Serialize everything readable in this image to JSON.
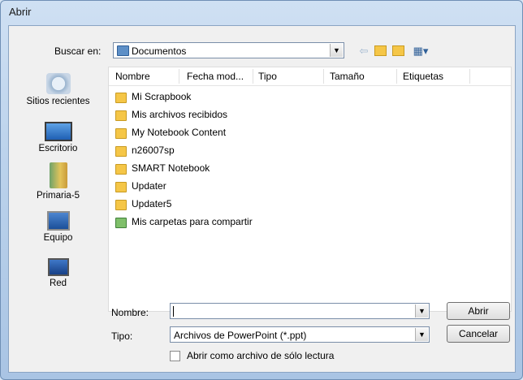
{
  "window": {
    "title": "Abrir"
  },
  "toolbar": {
    "look_in_label": "Buscar en:",
    "look_in_value": "Documentos"
  },
  "places": [
    {
      "label": "Sitios recientes",
      "icon": "recent-places-icon"
    },
    {
      "label": "Escritorio",
      "icon": "desktop-icon"
    },
    {
      "label": "Primaria-5",
      "icon": "user-folder-icon"
    },
    {
      "label": "Equipo",
      "icon": "computer-icon"
    },
    {
      "label": "Red",
      "icon": "network-icon"
    }
  ],
  "columns": [
    "Nombre",
    "Fecha mod...",
    "Tipo",
    "Tamaño",
    "Etiquetas"
  ],
  "files": [
    {
      "name": "Mi Scrapbook",
      "icon": "folder-icon"
    },
    {
      "name": "Mis archivos recibidos",
      "icon": "folder-icon"
    },
    {
      "name": "My Notebook Content",
      "icon": "folder-icon"
    },
    {
      "name": "n26007sp",
      "icon": "folder-icon"
    },
    {
      "name": "SMART Notebook",
      "icon": "folder-icon"
    },
    {
      "name": "Updater",
      "icon": "folder-icon"
    },
    {
      "name": "Updater5",
      "icon": "folder-icon"
    },
    {
      "name": "Mis carpetas para compartir",
      "icon": "shared-folder-icon"
    }
  ],
  "footer": {
    "name_label": "Nombre:",
    "name_value": "",
    "type_label": "Tipo:",
    "type_value": "Archivos de PowerPoint (*.ppt)",
    "readonly_label": "Abrir como archivo de sólo lectura",
    "open_label": "Abrir",
    "cancel_label": "Cancelar"
  }
}
